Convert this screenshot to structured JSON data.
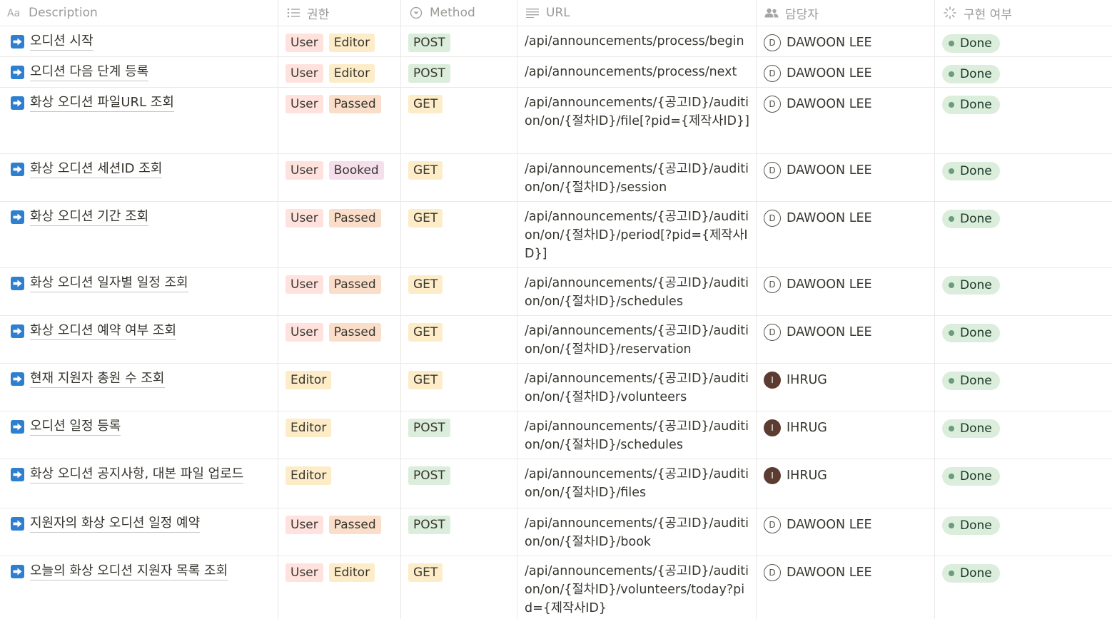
{
  "header": {
    "description": "Description",
    "permission": "권한",
    "method": "Method",
    "url": "URL",
    "assignee": "담당자",
    "status": "구현 여부"
  },
  "rows": [
    {
      "description": "오디션 시작",
      "permissions": [
        "User",
        "Editor"
      ],
      "method": "POST",
      "url": "/api/announcements/process/begin",
      "assignee": "DAWOON LEE",
      "avatar": "D",
      "status": "Done"
    },
    {
      "description": "오디션 다음 단계 등록",
      "permissions": [
        "User",
        "Editor"
      ],
      "method": "POST",
      "url": "/api/announcements/process/next",
      "assignee": "DAWOON LEE",
      "avatar": "D",
      "status": "Done"
    },
    {
      "description": "화상 오디션 파일URL 조회",
      "permissions": [
        "User",
        "Passed"
      ],
      "method": "GET",
      "url": "/api/announcements/{공고ID}/audition/on/{절차ID}/file[?pid={제작사ID}]",
      "assignee": "DAWOON LEE",
      "avatar": "D",
      "status": "Done"
    },
    {
      "description": "화상 오디션 세션ID 조회",
      "permissions": [
        "User",
        "Booked"
      ],
      "method": "GET",
      "url": "/api/announcements/{공고ID}/audition/on/{절차ID}/session",
      "assignee": "DAWOON LEE",
      "avatar": "D",
      "status": "Done"
    },
    {
      "description": "화상 오디션 기간 조회",
      "permissions": [
        "User",
        "Passed"
      ],
      "method": "GET",
      "url": "/api/announcements/{공고ID}/audition/on/{절차ID}/period[?pid={제작사ID}]",
      "assignee": "DAWOON LEE",
      "avatar": "D",
      "status": "Done"
    },
    {
      "description": "화상 오디션 일자별 일정 조회",
      "permissions": [
        "User",
        "Passed"
      ],
      "method": "GET",
      "url": "/api/announcements/{공고ID}/audition/on/{절차ID}/schedules",
      "assignee": "DAWOON LEE",
      "avatar": "D",
      "status": "Done"
    },
    {
      "description": "화상 오디션 예약 여부 조회",
      "permissions": [
        "User",
        "Passed"
      ],
      "method": "GET",
      "url": "/api/announcements/{공고ID}/audition/on/{절차ID}/reservation",
      "assignee": "DAWOON LEE",
      "avatar": "D",
      "status": "Done"
    },
    {
      "description": "현재 지원자 총원 수 조회",
      "permissions": [
        "Editor"
      ],
      "method": "GET",
      "url": "/api/announcements/{공고ID}/audition/on/{절차ID}/volunteers",
      "assignee": "IHRUG",
      "avatar": "I",
      "status": "Done"
    },
    {
      "description": "오디션 일정 등록",
      "permissions": [
        "Editor"
      ],
      "method": "POST",
      "url": "/api/announcements/{공고ID}/audition/on/{절차ID}/schedules",
      "assignee": "IHRUG",
      "avatar": "I",
      "status": "Done"
    },
    {
      "description": "화상 오디션 공지사항, 대본 파일 업로드",
      "permissions": [
        "Editor"
      ],
      "method": "POST",
      "url": "/api/announcements/{공고ID}/audition/on/{절차ID}/files",
      "assignee": "IHRUG",
      "avatar": "I",
      "status": "Done"
    },
    {
      "description": "지원자의 화상 오디션 일정 예약",
      "permissions": [
        "User",
        "Passed"
      ],
      "method": "POST",
      "url": "/api/announcements/{공고ID}/audition/on/{절차ID}/book",
      "assignee": "DAWOON LEE",
      "avatar": "D",
      "status": "Done"
    },
    {
      "description": "오늘의 화상 오디션 지원자 목록 조회",
      "permissions": [
        "User",
        "Editor"
      ],
      "method": "GET",
      "url": "/api/announcements/{공고ID}/audition/on/{절차ID}/volunteers/today?pid={제작사ID}",
      "assignee": "DAWOON LEE",
      "avatar": "D",
      "status": "Done"
    }
  ],
  "colors": {
    "user": "#ffe2dd",
    "editor": "#fdecc8",
    "passed": "#fadec9",
    "booked": "#f4dfeb",
    "post": "#dbeddb",
    "get": "#fdecc8",
    "done": "#dbeddb",
    "arrow": "#2f7fd1"
  }
}
